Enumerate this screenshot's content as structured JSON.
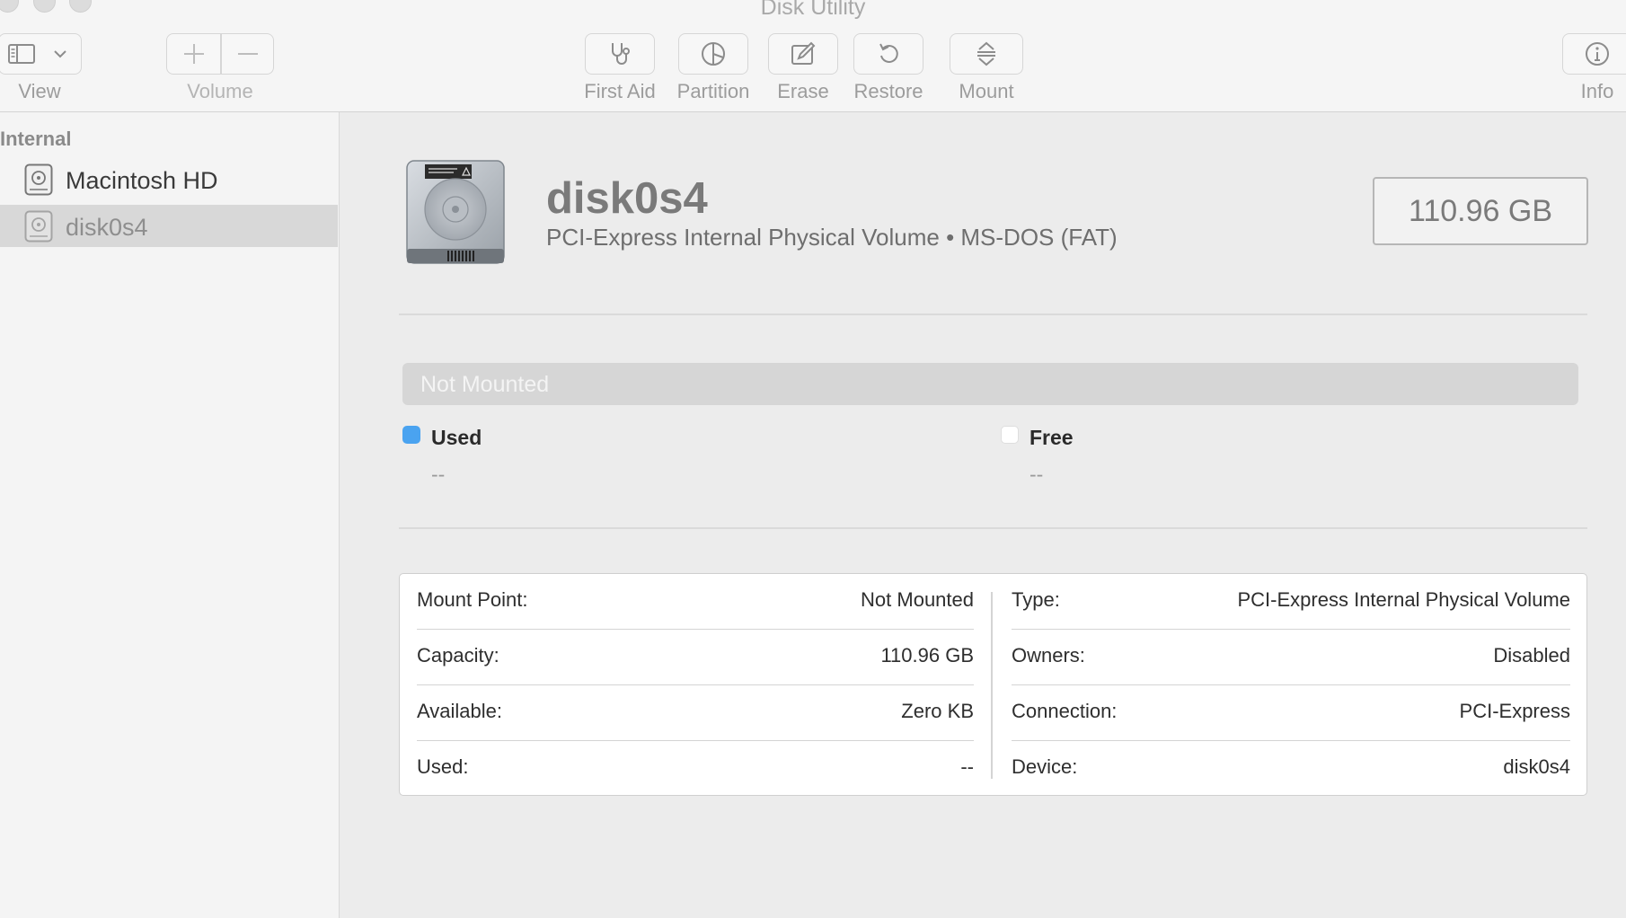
{
  "window": {
    "title": "Disk Utility"
  },
  "toolbar": {
    "view_label": "View",
    "volume_label": "Volume",
    "first_aid_label": "First Aid",
    "partition_label": "Partition",
    "erase_label": "Erase",
    "restore_label": "Restore",
    "mount_label": "Mount",
    "info_label": "Info"
  },
  "sidebar": {
    "section_title": "Internal",
    "items": [
      {
        "label": "Macintosh HD",
        "icon": "hard-drive-icon",
        "selected": false
      },
      {
        "label": "disk0s4",
        "icon": "hard-drive-icon",
        "selected": true
      }
    ]
  },
  "volume": {
    "name": "disk0s4",
    "subtitle": "PCI-Express Internal Physical Volume • MS-DOS (FAT)",
    "size": "110.96 GB",
    "icon": "internal-hard-drive-icon"
  },
  "usage": {
    "status": "Not Mounted",
    "used": {
      "label": "Used",
      "value": "--",
      "color": "#4aa3f0"
    },
    "free": {
      "label": "Free",
      "value": "--",
      "color": "#ffffff"
    }
  },
  "info": {
    "left": [
      {
        "key": "Mount Point:",
        "value": "Not Mounted"
      },
      {
        "key": "Capacity:",
        "value": "110.96 GB"
      },
      {
        "key": "Available:",
        "value": "Zero KB"
      },
      {
        "key": "Used:",
        "value": "--"
      }
    ],
    "right": [
      {
        "key": "Type:",
        "value": "PCI-Express Internal Physical Volume"
      },
      {
        "key": "Owners:",
        "value": "Disabled"
      },
      {
        "key": "Connection:",
        "value": "PCI-Express"
      },
      {
        "key": "Device:",
        "value": "disk0s4"
      }
    ]
  }
}
